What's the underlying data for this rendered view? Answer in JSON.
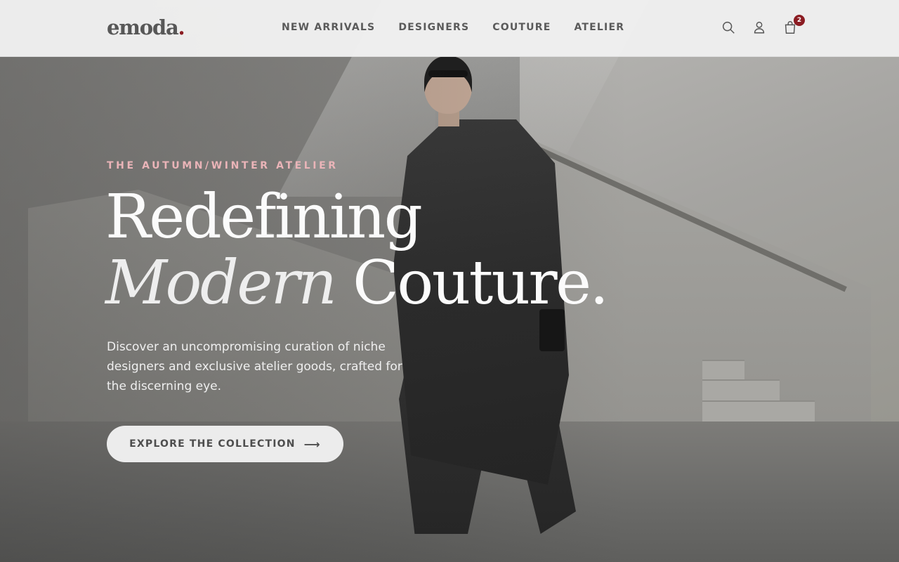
{
  "brand": {
    "logo_text": "emoda",
    "logo_dot": "."
  },
  "nav": {
    "items": [
      {
        "label": "NEW ARRIVALS"
      },
      {
        "label": "DESIGNERS"
      },
      {
        "label": "COUTURE"
      },
      {
        "label": "ATELIER"
      }
    ]
  },
  "header_icons": {
    "search": "search-icon",
    "account": "user-icon",
    "cart": "shopping-bag-icon",
    "cart_count": "2"
  },
  "hero": {
    "eyebrow": "THE AUTUMN/WINTER ATELIER",
    "headline_line1": "Redefining",
    "headline_italic": "Modern",
    "headline_rest": " Couture.",
    "description": "Discover an uncompromising curation of niche designers and exclusive atelier goods, crafted for the discerning eye.",
    "cta_label": "EXPLORE THE COLLECTION",
    "cta_icon": "arrow-right-icon"
  },
  "colors": {
    "accent": "#8b1c22",
    "eyebrow": "#eab4b8",
    "header_bg": "#f1f1f1",
    "text_dark": "#575757"
  }
}
